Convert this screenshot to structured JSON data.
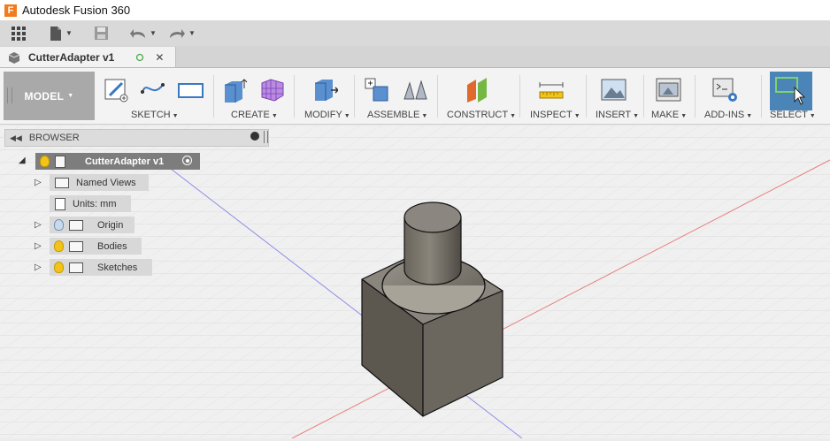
{
  "app": {
    "title": "Autodesk Fusion 360",
    "logo_letter": "F"
  },
  "document_tab": {
    "label": "CutterAdapter v1",
    "close": "✕"
  },
  "workspace": {
    "label": "MODEL"
  },
  "toolbar": {
    "groups": [
      {
        "label": "SKETCH"
      },
      {
        "label": "CREATE"
      },
      {
        "label": "MODIFY"
      },
      {
        "label": "ASSEMBLE"
      },
      {
        "label": "CONSTRUCT"
      },
      {
        "label": "INSPECT"
      },
      {
        "label": "INSERT"
      },
      {
        "label": "MAKE"
      },
      {
        "label": "ADD-INS"
      },
      {
        "label": "SELECT"
      }
    ]
  },
  "browser": {
    "title": "BROWSER",
    "root": {
      "label": "CutterAdapter v1"
    },
    "items": [
      {
        "label": "Named Views"
      },
      {
        "label": "Units: mm"
      },
      {
        "label": "Origin"
      },
      {
        "label": "Bodies"
      },
      {
        "label": "Sketches"
      }
    ]
  },
  "colors": {
    "select_accent": "#4b85b8",
    "bulb_on": "#f2c318",
    "axis_red": "#e05555",
    "axis_blue": "#6a6ae0"
  }
}
